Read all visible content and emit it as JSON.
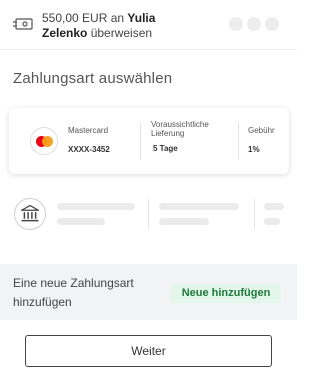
{
  "header": {
    "amount": "550,00 EUR",
    "connector": "an",
    "recipient_first": "Yulia",
    "recipient_last": "Zelenko",
    "action": "überweisen",
    "icon": "banknote-icon"
  },
  "section_title": "Zahlungsart auswählen",
  "selected_method": {
    "brand": "Mastercard",
    "number": "XXXX-3452",
    "delivery_label": "Voraussichtliche Lieferung",
    "delivery_value": "5 Tage",
    "fee_label": "Gebühr",
    "fee_value": "1%",
    "icon": "mastercard-icon"
  },
  "bank_method": {
    "icon": "bank-icon"
  },
  "add_method": {
    "text": "Eine neue Zahlungsart hinzufügen",
    "button_label": "Neue hinzufügen"
  },
  "footer": {
    "continue_label": "Weiter"
  },
  "colors": {
    "accent_green_bg": "#e3f6ea",
    "accent_green_text": "#1e7a3c",
    "mastercard_red": "#eb001b",
    "mastercard_orange": "#f79e1b"
  }
}
